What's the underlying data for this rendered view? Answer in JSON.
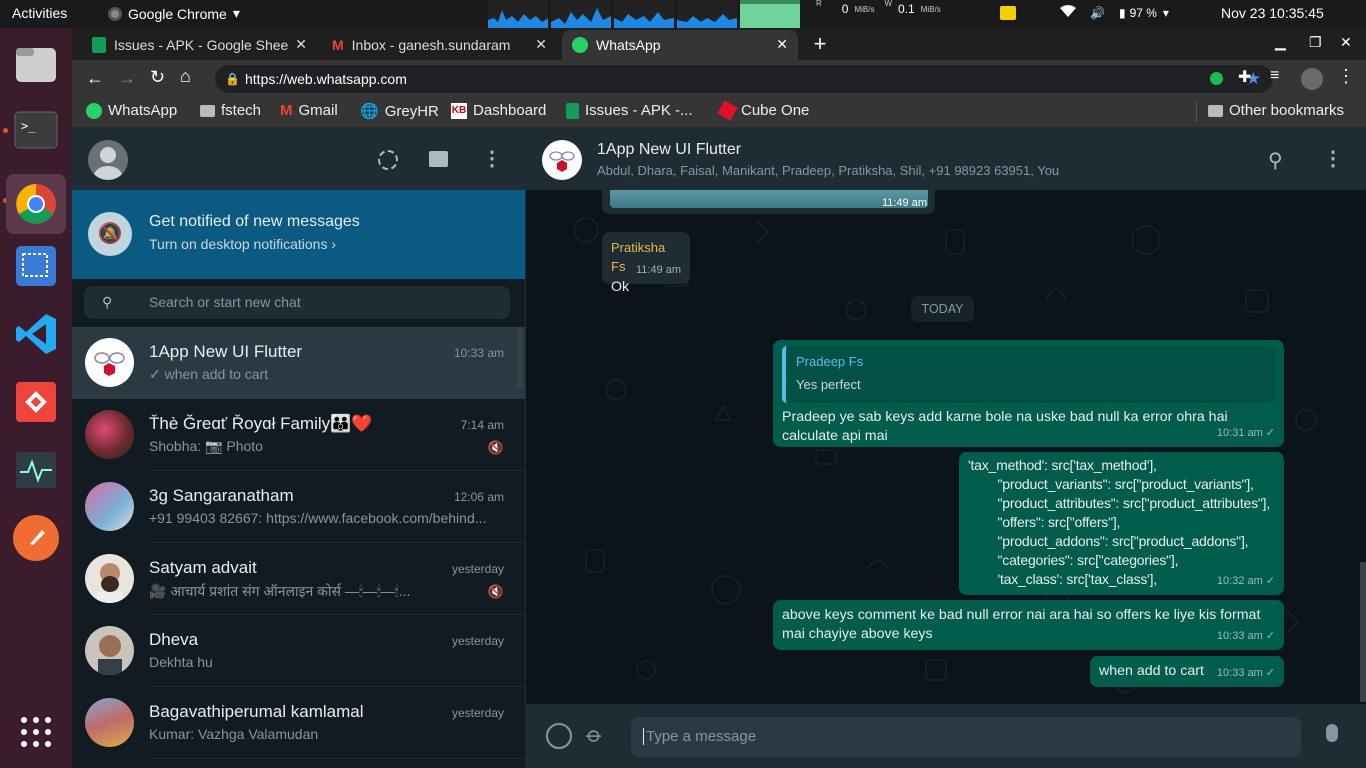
{
  "os": {
    "activities": "Activities",
    "app_name": "Google Chrome",
    "net_down": "0",
    "net_up": "0.1",
    "net_unit": "MiB/s",
    "net_r": "R",
    "net_w": "W",
    "battery": "97 %",
    "datetime": "Nov 23  10:35:45"
  },
  "browser": {
    "tabs": [
      {
        "title": "Issues - APK - Google Shee"
      },
      {
        "title": "Inbox - ganesh.sundaram"
      },
      {
        "title": "WhatsApp"
      }
    ],
    "url": "https://web.whatsapp.com",
    "bookmarks": [
      "WhatsApp",
      "fstech",
      "Gmail",
      "GreyHR",
      "Dashboard",
      "Issues - APK -...",
      "Cube One"
    ],
    "other_bookmarks": "Other bookmarks"
  },
  "sidebar": {
    "notification_title": "Get notified of new messages",
    "notification_sub": "Turn on desktop notifications ›",
    "search_placeholder": "Search or start new chat",
    "chats": [
      {
        "name": "1App New UI Flutter",
        "time": "10:33 am",
        "preview": "✓ when add to cart"
      },
      {
        "name": "Ťhè Ğreɑť Řoyɑł Family👪❤️",
        "time": "7:14 am",
        "preview": "Shobha: 📷 Photo"
      },
      {
        "name": "3g Sangaranatham",
        "time": "12:06 am",
        "preview": "+91 99403 82667: https://www.facebook.com/behind..."
      },
      {
        "name": "Satyam advait",
        "time": "yesterday",
        "preview": "🎥 आचार्य प्रशांत संग ऑनलाइन कोर्स —🕯—🕯—🕯..."
      },
      {
        "name": "Dheva",
        "time": "yesterday",
        "preview": "Dekhta hu"
      },
      {
        "name": "Bagavathiperumal kamlamal",
        "time": "yesterday",
        "preview": "Kumar: Vazhga Valamudan"
      }
    ]
  },
  "conversation": {
    "title": "1App New UI Flutter",
    "members": "Abdul, Dhara, Faisal, Manikant, Pradeep, Pratiksha, Shil, +91 98923 63951, You",
    "image_time": "11:49 am",
    "day_divider": "TODAY",
    "messages": [
      {
        "sender": "Pratiksha Fs",
        "text": "Ok",
        "time": "11:49 am"
      },
      {
        "quote_sender": "Pradeep Fs",
        "quote_text": "Yes perfect",
        "text": "Pradeep ye sab keys add karne bole na uske bad null ka error ohra hai calculate api mai",
        "time": "10:31 am"
      },
      {
        "text": "'tax_method': src['tax_method'],\n        \"product_variants\": src[\"product_variants\"],\n        \"product_attributes\": src[\"product_attributes\"],\n        \"offers\": src[\"offers\"],\n        \"product_addons\": src[\"product_addons\"],\n        \"categories\": src[\"categories\"],\n        'tax_class': src['tax_class'],",
        "time": "10:32 am"
      },
      {
        "text": "above keys comment ke bad null error nai ara hai so offers ke liye kis format mai chayiye above keys",
        "time": "10:33 am"
      },
      {
        "text": "when add to cart",
        "time": "10:33 am"
      }
    ],
    "composer_placeholder": "Type a message"
  }
}
